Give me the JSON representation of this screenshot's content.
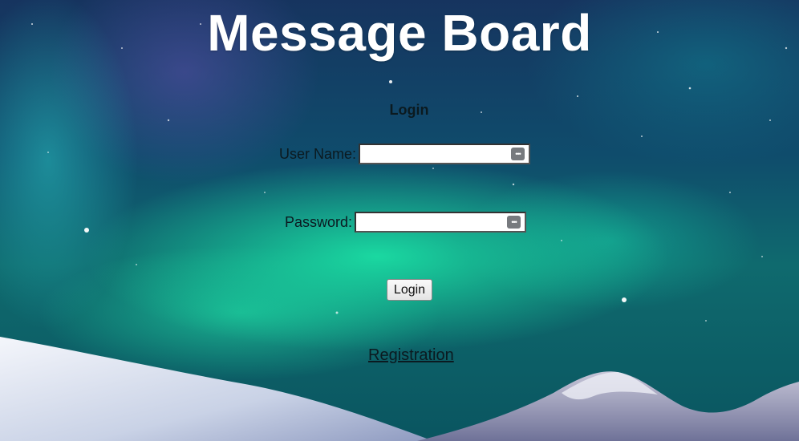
{
  "page": {
    "title": "Message Board"
  },
  "login_form": {
    "heading": "Login",
    "username_label": "User Name:",
    "username_value": "",
    "password_label": "Password:",
    "password_value": "",
    "password_manager_icon": "key-dots-icon",
    "submit_label": "Login",
    "registration_link": "Registration"
  },
  "colors": {
    "title_text": "#ffffff",
    "form_text": "#0b1a20",
    "aurora_green": "#1cecaa",
    "sky_dark": "#16345f",
    "snow": "#e8edf5"
  }
}
